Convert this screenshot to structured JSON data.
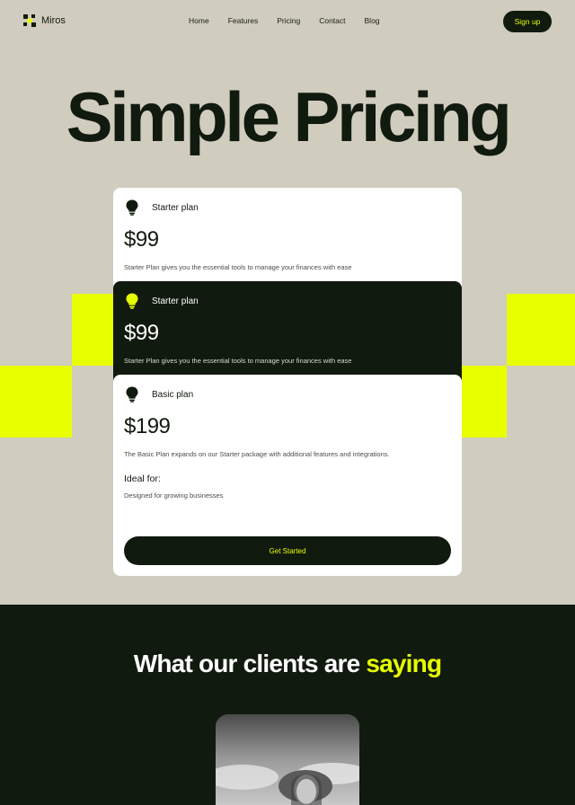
{
  "brand": {
    "name": "Miros",
    "accent": "#e6ff00",
    "dark": "#111a0f",
    "background": "#d0ccbe"
  },
  "nav": {
    "links": [
      "Home",
      "Features",
      "Pricing",
      "Contact",
      "Blog"
    ],
    "signup_label": "Sign up"
  },
  "hero": {
    "title": "Simple Pricing"
  },
  "plans": [
    {
      "icon": "lightbulb-icon",
      "name": "Starter plan",
      "price": "$99",
      "description": "Starter Plan gives you the essential tools to manage your finances with ease"
    },
    {
      "icon": "lightbulb-icon",
      "name": "Starter plan",
      "price": "$99",
      "description": "Starter Plan gives you the essential tools to manage your finances with ease"
    },
    {
      "icon": "lightbulb-icon",
      "name": "Basic plan",
      "price": "$199",
      "description": "The Basic Plan expands on our Starter package with additional features and integrations.",
      "ideal_label": "Ideal for:",
      "ideal_desc": "Designed for growing businesses",
      "cta_label": "Get Started"
    }
  ],
  "testimonials": {
    "title_main": "What our clients are",
    "title_highlight": "saying"
  }
}
